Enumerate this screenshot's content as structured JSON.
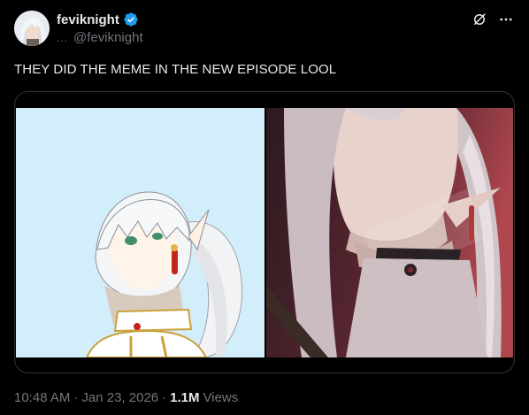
{
  "post": {
    "display_name": "feviknight",
    "handle": "@feviknight",
    "handle_prefix": "...",
    "verified": true,
    "text": "THEY DID THE MEME IN THE NEW EPISODE LOOL",
    "time": "10:48 AM",
    "separator": "·",
    "date": "Jan 23, 2026",
    "views_count": "1.1M",
    "views_label": "Views"
  },
  "icons": {
    "verified": "verified-badge-icon",
    "grok": "grok-icon",
    "more": "more-icon"
  },
  "colors": {
    "background": "#000000",
    "text_primary": "#e7e9ea",
    "text_secondary": "#71767b",
    "verified_blue": "#1d9bf0",
    "border": "#2f3336"
  },
  "media": [
    {
      "kind": "illustration",
      "background": "#d2eefa"
    },
    {
      "kind": "anime-screenshot",
      "background": "#3a1c23"
    }
  ]
}
